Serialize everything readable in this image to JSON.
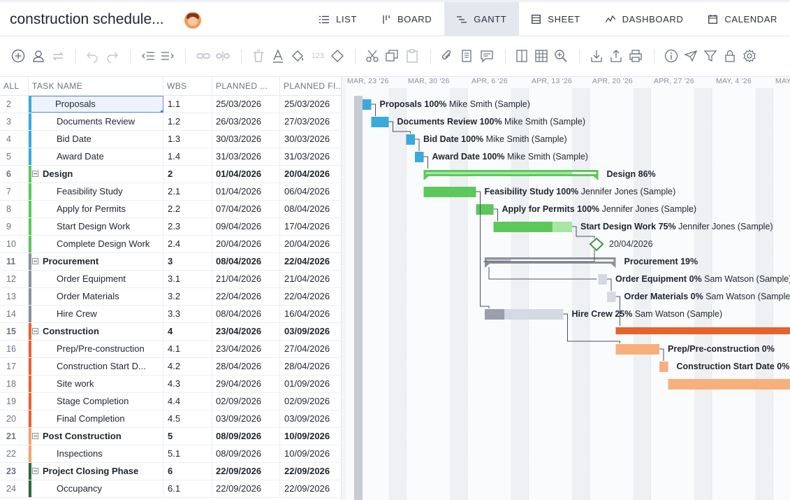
{
  "app": {
    "title": "construction schedule...",
    "tabs": [
      {
        "label": "LIST",
        "icon": "list-icon",
        "active": false
      },
      {
        "label": "BOARD",
        "icon": "board-icon",
        "active": false
      },
      {
        "label": "GANTT",
        "icon": "gantt-icon",
        "active": true
      },
      {
        "label": "SHEET",
        "icon": "sheet-icon",
        "active": false
      },
      {
        "label": "DASHBOARD",
        "icon": "dashboard-icon",
        "active": false
      },
      {
        "label": "CALENDAR",
        "icon": "calendar-icon",
        "active": false
      }
    ]
  },
  "toolbar": {
    "faded_count": "123",
    "icons": [
      "add-task-icon",
      "assign-user-icon",
      "sync-icon",
      "undo-icon",
      "redo-icon",
      "outdent-icon",
      "indent-icon",
      "link-icon",
      "unlink-icon",
      "delete-icon",
      "font-color-icon",
      "fill-color-icon",
      "number-format-icon",
      "milestone-icon",
      "cut-icon",
      "copy-icon",
      "paste-icon",
      "attachment-icon",
      "notes-icon",
      "comment-icon",
      "columns-icon",
      "grid-icon",
      "zoom-icon",
      "import-icon",
      "export-icon",
      "print-icon",
      "info-icon",
      "send-icon",
      "filter-icon",
      "lock-icon",
      "settings-icon"
    ]
  },
  "grid": {
    "headers": {
      "all": "ALL",
      "task_name": "TASK NAME",
      "wbs": "WBS",
      "planned_start": "PLANNED ...",
      "planned_finish": "PLANNED FI..."
    },
    "rows": [
      {
        "num": "2",
        "name": "Proposals",
        "wbs": "1.1",
        "start": "25/03/2026",
        "finish": "25/03/2026",
        "group": false,
        "color": "#3aa9dc",
        "selected": true
      },
      {
        "num": "3",
        "name": "Documents Review",
        "wbs": "1.2",
        "start": "26/03/2026",
        "finish": "27/03/2026",
        "group": false,
        "color": "#3aa9dc"
      },
      {
        "num": "4",
        "name": "Bid Date",
        "wbs": "1.3",
        "start": "30/03/2026",
        "finish": "30/03/2026",
        "group": false,
        "color": "#3aa9dc"
      },
      {
        "num": "5",
        "name": "Award Date",
        "wbs": "1.4",
        "start": "31/03/2026",
        "finish": "31/03/2026",
        "group": false,
        "color": "#3aa9dc"
      },
      {
        "num": "6",
        "name": "Design",
        "wbs": "2",
        "start": "01/04/2026",
        "finish": "20/04/2026",
        "group": true,
        "color": "#5cc85a"
      },
      {
        "num": "7",
        "name": "Feasibility Study",
        "wbs": "2.1",
        "start": "01/04/2026",
        "finish": "06/04/2026",
        "group": false,
        "color": "#5cc85a"
      },
      {
        "num": "8",
        "name": "Apply for Permits",
        "wbs": "2.2",
        "start": "07/04/2026",
        "finish": "08/04/2026",
        "group": false,
        "color": "#5cc85a"
      },
      {
        "num": "9",
        "name": "Start Design Work",
        "wbs": "2.3",
        "start": "09/04/2026",
        "finish": "17/04/2026",
        "group": false,
        "color": "#5cc85a"
      },
      {
        "num": "10",
        "name": "Complete Design Work",
        "wbs": "2.4",
        "start": "20/04/2026",
        "finish": "20/04/2026",
        "group": false,
        "color": "#5cc85a"
      },
      {
        "num": "11",
        "name": "Procurement",
        "wbs": "3",
        "start": "08/04/2026",
        "finish": "22/04/2026",
        "group": true,
        "color": "#8c919c"
      },
      {
        "num": "12",
        "name": "Order Equipment",
        "wbs": "3.1",
        "start": "21/04/2026",
        "finish": "21/04/2026",
        "group": false,
        "color": "#8c919c"
      },
      {
        "num": "13",
        "name": "Order Materials",
        "wbs": "3.2",
        "start": "22/04/2026",
        "finish": "22/04/2026",
        "group": false,
        "color": "#8c919c"
      },
      {
        "num": "14",
        "name": "Hire Crew",
        "wbs": "3.3",
        "start": "08/04/2026",
        "finish": "16/04/2026",
        "group": false,
        "color": "#8c919c"
      },
      {
        "num": "15",
        "name": "Construction",
        "wbs": "4",
        "start": "23/04/2026",
        "finish": "03/09/2026",
        "group": true,
        "color": "#e8622c"
      },
      {
        "num": "16",
        "name": "Prep/Pre-construction",
        "wbs": "4.1",
        "start": "23/04/2026",
        "finish": "27/04/2026",
        "group": false,
        "color": "#e8622c"
      },
      {
        "num": "17",
        "name": "Construction Start D...",
        "wbs": "4.2",
        "start": "28/04/2026",
        "finish": "28/04/2026",
        "group": false,
        "color": "#e8622c"
      },
      {
        "num": "18",
        "name": "Site work",
        "wbs": "4.3",
        "start": "29/04/2026",
        "finish": "01/09/2026",
        "group": false,
        "color": "#e8622c"
      },
      {
        "num": "19",
        "name": "Stage Completion",
        "wbs": "4.4",
        "start": "02/09/2026",
        "finish": "02/09/2026",
        "group": false,
        "color": "#e8622c"
      },
      {
        "num": "20",
        "name": "Final Completion",
        "wbs": "4.5",
        "start": "03/09/2026",
        "finish": "03/09/2026",
        "group": false,
        "color": "#e8622c"
      },
      {
        "num": "21",
        "name": "Post Construction",
        "wbs": "5",
        "start": "08/09/2026",
        "finish": "10/09/2026",
        "group": true,
        "color": "#f4a46e"
      },
      {
        "num": "22",
        "name": "Inspections",
        "wbs": "5.1",
        "start": "08/09/2026",
        "finish": "10/09/2026",
        "group": false,
        "color": "#f4a46e"
      },
      {
        "num": "23",
        "name": "Project Closing Phase",
        "wbs": "6",
        "start": "22/09/2026",
        "finish": "22/09/2026",
        "group": true,
        "color": "#2c6b3a"
      },
      {
        "num": "24",
        "name": "Occupancy",
        "wbs": "6.1",
        "start": "22/09/2026",
        "finish": "22/09/2026",
        "group": false,
        "color": "#2c6b3a"
      }
    ]
  },
  "gantt": {
    "week_labels": [
      "MAR, 23 '26",
      "MAR, 30 '26",
      "APR, 6 '26",
      "APR, 13 '26",
      "APR, 20 '26",
      "APR, 27 '26",
      "MAY, 4 '26",
      "MAY"
    ],
    "bars": [
      {
        "row": 0,
        "start": "2026-03-25",
        "end": "2026-03-25",
        "kind": "task",
        "progress": 1.0,
        "name": "Proposals",
        "pct": "100%",
        "assignee": "Mike Smith (Sample)",
        "color": "#3aa9dc",
        "light": "#a8daf0"
      },
      {
        "row": 1,
        "start": "2026-03-26",
        "end": "2026-03-27",
        "kind": "task",
        "progress": 1.0,
        "name": "Documents Review",
        "pct": "100%",
        "assignee": "Mike Smith (Sample)",
        "color": "#3aa9dc",
        "light": "#a8daf0"
      },
      {
        "row": 2,
        "start": "2026-03-30",
        "end": "2026-03-30",
        "kind": "task",
        "progress": 1.0,
        "name": "Bid Date",
        "pct": "100%",
        "assignee": "Mike Smith (Sample)",
        "color": "#3aa9dc",
        "light": "#a8daf0"
      },
      {
        "row": 3,
        "start": "2026-03-31",
        "end": "2026-03-31",
        "kind": "task",
        "progress": 1.0,
        "name": "Award Date",
        "pct": "100%",
        "assignee": "Mike Smith (Sample)",
        "color": "#3aa9dc",
        "light": "#a8daf0"
      },
      {
        "row": 4,
        "start": "2026-04-01",
        "end": "2026-04-20",
        "kind": "group",
        "progress": 0.86,
        "name": "Design",
        "pct": "86%",
        "assignee": "",
        "color": "#5cc85a",
        "light": "#a8e6a3"
      },
      {
        "row": 5,
        "start": "2026-04-01",
        "end": "2026-04-06",
        "kind": "task",
        "progress": 1.0,
        "name": "Feasibility Study",
        "pct": "100%",
        "assignee": "Jennifer Jones (Sample)",
        "color": "#5cc85a",
        "light": "#a8e6a3"
      },
      {
        "row": 6,
        "start": "2026-04-07",
        "end": "2026-04-08",
        "kind": "task",
        "progress": 1.0,
        "name": "Apply for Permits",
        "pct": "100%",
        "assignee": "Jennifer Jones (Sample)",
        "color": "#5cc85a",
        "light": "#a8e6a3"
      },
      {
        "row": 7,
        "start": "2026-04-09",
        "end": "2026-04-17",
        "kind": "task",
        "progress": 0.75,
        "name": "Start Design Work",
        "pct": "75%",
        "assignee": "Jennifer Jones (Sample)",
        "color": "#5cc85a",
        "light": "#a8e6a3"
      },
      {
        "row": 8,
        "start": "2026-04-20",
        "end": "2026-04-20",
        "kind": "milestone",
        "progress": 0,
        "name": "",
        "pct": "",
        "assignee": "",
        "date_label": "20/04/2026",
        "color": "#3f9a3c",
        "light": "#ffffff"
      },
      {
        "row": 9,
        "start": "2026-04-08",
        "end": "2026-04-22",
        "kind": "group",
        "progress": 0.19,
        "name": "Procurement",
        "pct": "19%",
        "assignee": "",
        "color": "#8c919c",
        "light": "#c9ccd3"
      },
      {
        "row": 10,
        "start": "2026-04-21",
        "end": "2026-04-21",
        "kind": "task",
        "progress": 0,
        "name": "Order Equipment",
        "pct": "0%",
        "assignee": "Sam Watson (Sample)",
        "color": "#8c919c",
        "light": "#d5d9e1"
      },
      {
        "row": 11,
        "start": "2026-04-22",
        "end": "2026-04-22",
        "kind": "task",
        "progress": 0,
        "name": "Order Materials",
        "pct": "0%",
        "assignee": "Sam Watson (Sample)",
        "color": "#8c919c",
        "light": "#d5d9e1"
      },
      {
        "row": 12,
        "start": "2026-04-08",
        "end": "2026-04-16",
        "kind": "task",
        "progress": 0.25,
        "name": "Hire Crew",
        "pct": "25%",
        "assignee": "Sam Watson (Sample)",
        "color": "#9a9fa9",
        "light": "#d5d9e1"
      },
      {
        "row": 13,
        "start": "2026-04-23",
        "end": "2026-09-03",
        "kind": "group",
        "progress": 0,
        "name": "",
        "pct": "",
        "assignee": "",
        "color": "#e8622c",
        "light": "#e8622c"
      },
      {
        "row": 14,
        "start": "2026-04-23",
        "end": "2026-04-27",
        "kind": "task",
        "progress": 0,
        "name": "Prep/Pre-construction",
        "pct": "0%",
        "assignee": "",
        "color": "#f4a46e",
        "light": "#f7b07c"
      },
      {
        "row": 15,
        "start": "2026-04-28",
        "end": "2026-04-28",
        "kind": "task",
        "progress": 0,
        "name": "Construction Start Date",
        "pct": "0%",
        "assignee": "",
        "color": "#f4a46e",
        "light": "#f7b07c"
      },
      {
        "row": 16,
        "start": "2026-04-29",
        "end": "2026-09-01",
        "kind": "task",
        "progress": 0,
        "name": "",
        "pct": "",
        "assignee": "",
        "color": "#f4a46e",
        "light": "#f7b07c"
      }
    ],
    "links": [
      [
        0,
        1
      ],
      [
        1,
        2
      ],
      [
        2,
        3
      ],
      [
        3,
        4
      ],
      [
        5,
        6
      ],
      [
        6,
        7
      ],
      [
        7,
        8
      ],
      [
        8,
        9
      ],
      [
        9,
        10
      ],
      [
        10,
        11
      ],
      [
        11,
        13
      ],
      [
        5,
        12
      ],
      [
        12,
        14
      ],
      [
        14,
        15
      ]
    ]
  }
}
